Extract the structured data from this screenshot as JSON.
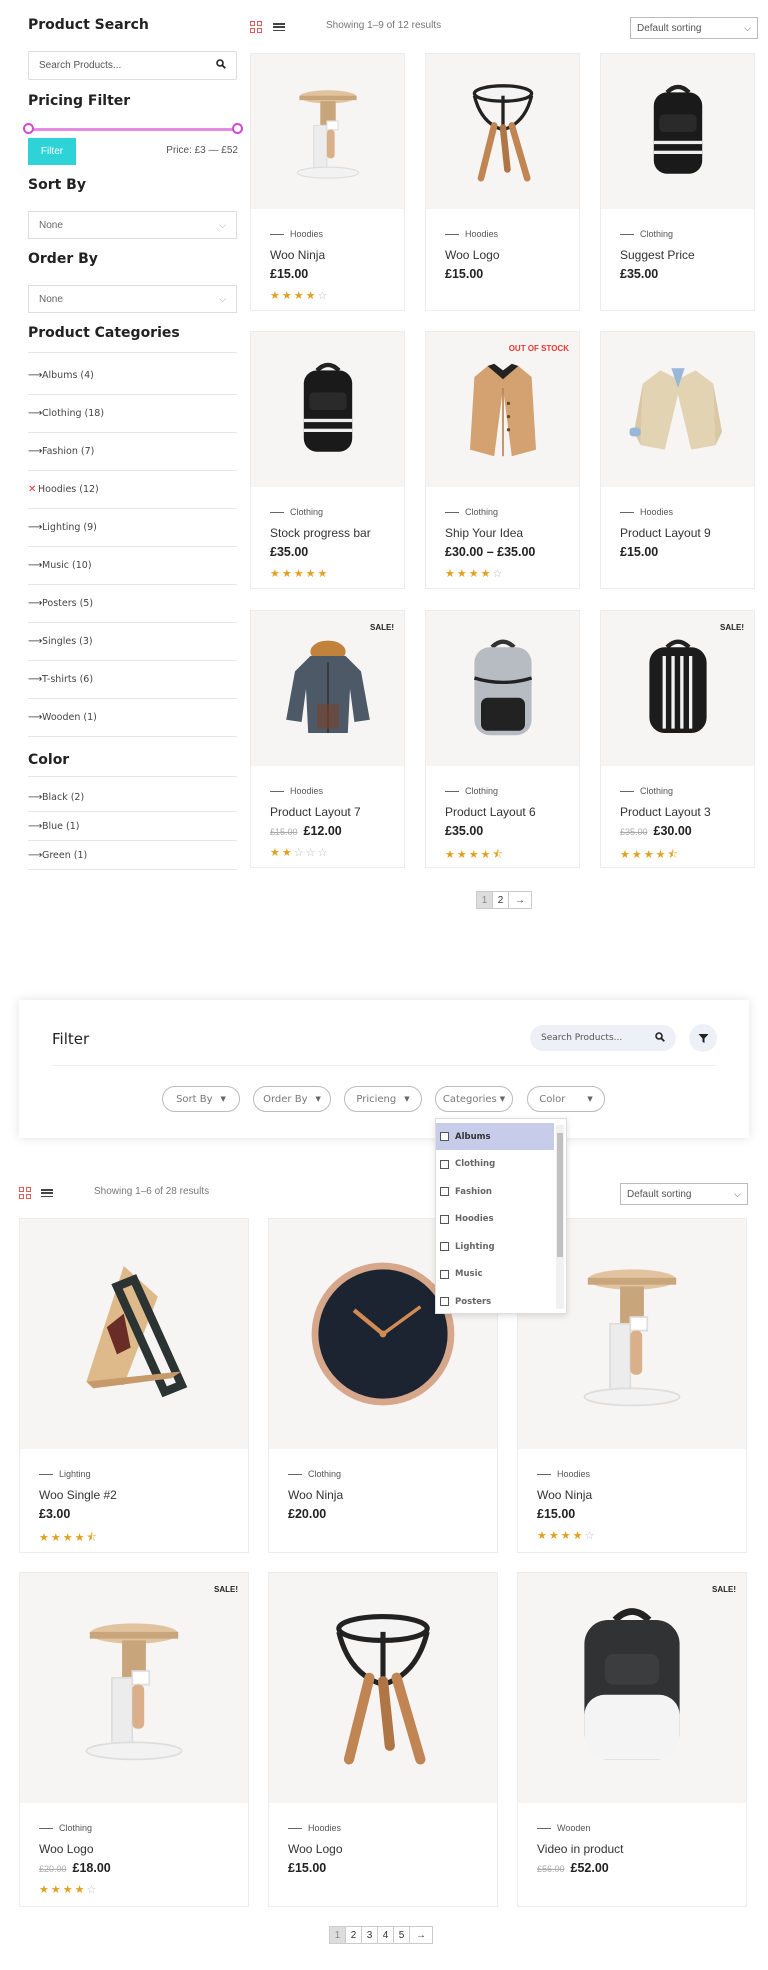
{
  "sidebar": {
    "search_title": "Product Search",
    "search_placeholder": "Search Products...",
    "pricing_title": "Pricing Filter",
    "filter_button": "Filter",
    "price_label": "Price: £3 — £52",
    "sort_title": "Sort By",
    "sort_value": "None",
    "order_title": "Order By",
    "order_value": "None",
    "categories_title": "Product Categories",
    "categories": [
      {
        "label": "Albums (4)"
      },
      {
        "label": "Clothing (18)"
      },
      {
        "label": "Fashion (7)"
      },
      {
        "label": "Hoodies (12)",
        "active": true
      },
      {
        "label": "Lighting (9)"
      },
      {
        "label": "Music (10)"
      },
      {
        "label": "Posters (5)"
      },
      {
        "label": "Singles (3)"
      },
      {
        "label": "T-shirts (6)"
      },
      {
        "label": "Wooden (1)"
      }
    ],
    "color_title": "Color",
    "colors": [
      {
        "label": "Black (2)"
      },
      {
        "label": "Blue (1)"
      },
      {
        "label": "Green (1)"
      }
    ]
  },
  "shop1": {
    "result_count": "Showing 1–9 of 12 results",
    "sort": "Default sorting",
    "products": [
      {
        "cat": "Hoodies",
        "name": "Woo Ninja",
        "price": "£15.00",
        "old": "",
        "rating": 4,
        "badge": "",
        "img": "stool"
      },
      {
        "cat": "Hoodies",
        "name": "Woo Logo",
        "price": "£15.00",
        "old": "",
        "rating": 0,
        "badge": "",
        "img": "tripod"
      },
      {
        "cat": "Clothing",
        "name": "Suggest Price",
        "price": "£35.00",
        "old": "",
        "rating": 0,
        "badge": "",
        "img": "backpack"
      },
      {
        "cat": "Clothing",
        "name": "Stock progress bar",
        "price": "£35.00",
        "old": "",
        "rating": 5,
        "badge": "",
        "img": "backpack"
      },
      {
        "cat": "Clothing",
        "name": "Ship Your Idea",
        "price": "£30.00 – £35.00",
        "old": "",
        "rating": 4,
        "badge": "OUT OF STOCK",
        "img": "coat"
      },
      {
        "cat": "Hoodies",
        "name": "Product Layout 9",
        "price": "£15.00",
        "old": "",
        "rating": 0,
        "badge": "",
        "img": "blazer"
      },
      {
        "cat": "Hoodies",
        "name": "Product Layout 7",
        "price": "£12.00",
        "old": "£15.00",
        "rating": 2,
        "badge": "SALE!",
        "img": "parka"
      },
      {
        "cat": "Clothing",
        "name": "Product Layout 6",
        "price": "£35.00",
        "old": "",
        "rating": 4.5,
        "badge": "",
        "img": "greybag"
      },
      {
        "cat": "Clothing",
        "name": "Product Layout 3",
        "price": "£30.00",
        "old": "£35.00",
        "rating": 4.5,
        "badge": "SALE!",
        "img": "stripebag"
      }
    ],
    "pages": [
      "1",
      "2",
      "→"
    ]
  },
  "filter_panel": {
    "title": "Filter",
    "search_placeholder": "Search Products...",
    "pills": [
      "Sort By",
      "Order By",
      "Pricieng",
      "Categories",
      "Color"
    ],
    "dropdown": [
      "Albums",
      "Clothing",
      "Fashion",
      "Hoodies",
      "Lighting",
      "Music",
      "Posters"
    ]
  },
  "shop2": {
    "result_count": "Showing 1–6 of 28 results",
    "sort": "Default sorting",
    "products": [
      {
        "cat": "Lighting",
        "name": "Woo Single #2",
        "price": "£3.00",
        "old": "",
        "rating": 4.5,
        "badge": "",
        "img": "chair"
      },
      {
        "cat": "Clothing",
        "name": "Woo Ninja",
        "price": "£20.00",
        "old": "",
        "rating": 0,
        "badge": "",
        "img": "clock"
      },
      {
        "cat": "Hoodies",
        "name": "Woo Ninja",
        "price": "£15.00",
        "old": "",
        "rating": 4,
        "badge": "",
        "img": "stool"
      },
      {
        "cat": "Clothing",
        "name": "Woo Logo",
        "price": "£18.00",
        "old": "£20.00",
        "rating": 4,
        "badge": "SALE!",
        "img": "stool"
      },
      {
        "cat": "Hoodies",
        "name": "Woo Logo",
        "price": "£15.00",
        "old": "",
        "rating": 0,
        "badge": "",
        "img": "tripod"
      },
      {
        "cat": "Wooden",
        "name": "Video in product",
        "price": "£52.00",
        "old": "£56.00",
        "rating": 0,
        "badge": "SALE!",
        "img": "whitebag"
      }
    ],
    "pages": [
      "1",
      "2",
      "3",
      "4",
      "5",
      "→"
    ]
  },
  "colors": {
    "accent": "#2ed3d8",
    "slider": "#e58ce2",
    "star": "#e2a020",
    "oos": "#e53935"
  }
}
